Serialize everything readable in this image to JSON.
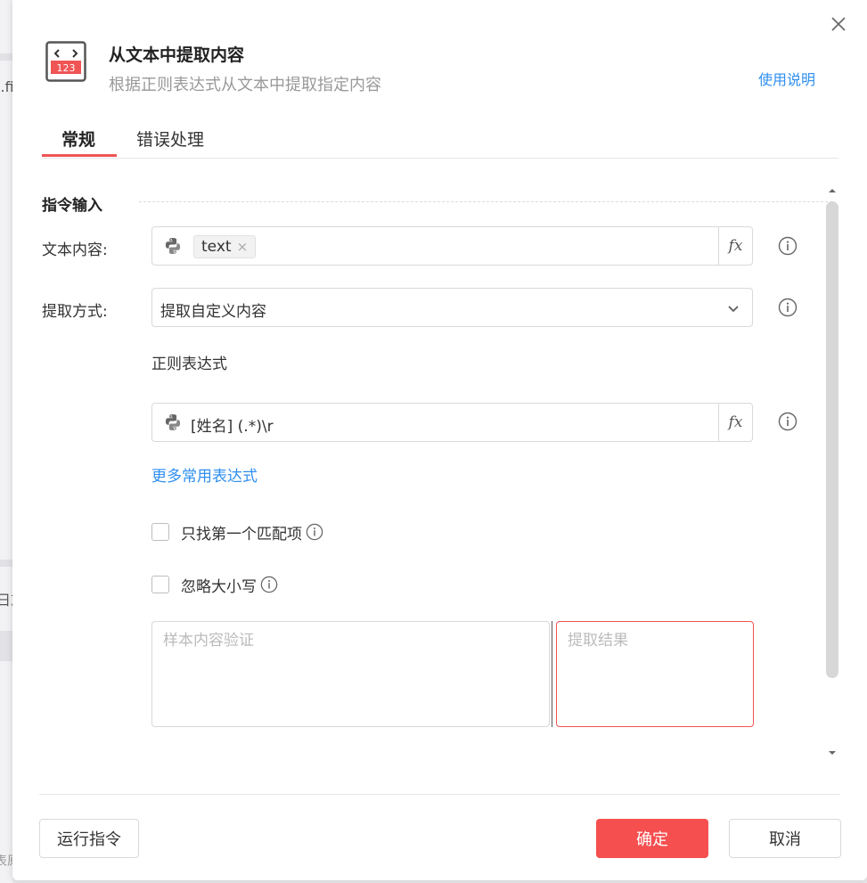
{
  "background": {
    "fragments": [
      "l.fi",
      "日志",
      "表原"
    ]
  },
  "dialog": {
    "title": "从文本中提取内容",
    "subtitle": "根据正则表达式从文本中提取指定内容",
    "help_link": "使用说明",
    "header_icon_text": "123"
  },
  "tabs": [
    {
      "label": "常规",
      "active": true
    },
    {
      "label": "错误处理",
      "active": false
    }
  ],
  "section": {
    "title": "指令输入"
  },
  "fields": {
    "text_content": {
      "label": "文本内容:",
      "tag": "text",
      "tag_close": "×",
      "fx": "fx"
    },
    "extract_method": {
      "label": "提取方式:",
      "value": "提取自定义内容"
    },
    "regex": {
      "label": "正则表达式",
      "value": "[姓名] (.*)\\r",
      "fx": "fx"
    },
    "more_link": "更多常用表达式",
    "first_match_only": {
      "label": "只找第一个匹配项",
      "checked": false
    },
    "ignore_case": {
      "label": "忽略大小写",
      "checked": false
    },
    "sample_placeholder": "样本内容验证",
    "result_placeholder": "提取结果"
  },
  "footer": {
    "run_label": "运行指令",
    "ok_label": "确定",
    "cancel_label": "取消"
  },
  "colors": {
    "accent": "#f54f4f",
    "link": "#2f8ff0"
  }
}
